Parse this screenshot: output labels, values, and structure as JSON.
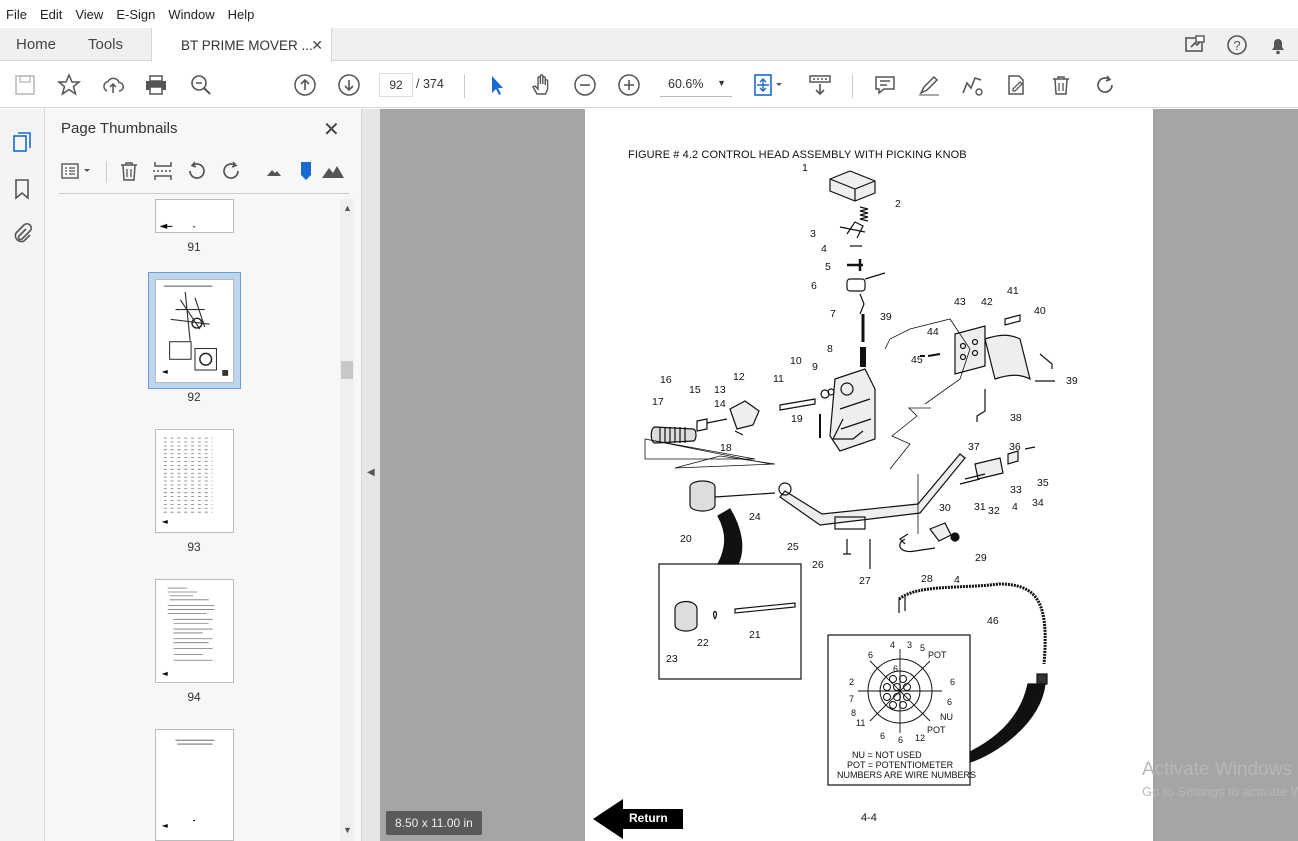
{
  "menu": [
    "File",
    "Edit",
    "View",
    "E-Sign",
    "Window",
    "Help"
  ],
  "tabs": {
    "home": "Home",
    "tools": "Tools",
    "document": "BT PRIME MOVER ..."
  },
  "toolbar": {
    "page_current": "92",
    "page_total": "/ 374",
    "zoom": "60.6%"
  },
  "panel": {
    "title": "Page Thumbnails"
  },
  "thumbnails": [
    "91",
    "92",
    "93",
    "94"
  ],
  "page": {
    "figure_title": "FIGURE # 4.2  CONTROL HEAD ASSEMBLY WITH PICKING KNOB",
    "page_number": "4-4",
    "return_label": "Return",
    "callouts": [
      "1",
      "2",
      "3",
      "4",
      "5",
      "6",
      "7",
      "8",
      "9",
      "10",
      "11",
      "12",
      "13",
      "14",
      "15",
      "16",
      "17",
      "18",
      "19",
      "20",
      "21",
      "22",
      "23",
      "24",
      "25",
      "26",
      "27",
      "28",
      "29",
      "30",
      "31",
      "32",
      "33",
      "34",
      "35",
      "36",
      "37",
      "38",
      "39",
      "40",
      "41",
      "42",
      "43",
      "44",
      "45",
      "46"
    ],
    "legend": [
      "NU = NOT USED",
      "POT = POTENTIOMETER",
      "NUMBERS ARE WIRE NUMBERS"
    ],
    "connector_wires": [
      "4",
      "3",
      "5",
      "POT",
      "6",
      "6",
      "2",
      "6",
      "7",
      "6",
      "8",
      "NU",
      "11",
      "POT",
      "6",
      "6",
      "12"
    ]
  },
  "status": {
    "page_size": "8.50 x 11.00 in"
  },
  "watermark": {
    "line1": "Activate Windows",
    "line2": "Go to Settings to activate Windows."
  }
}
